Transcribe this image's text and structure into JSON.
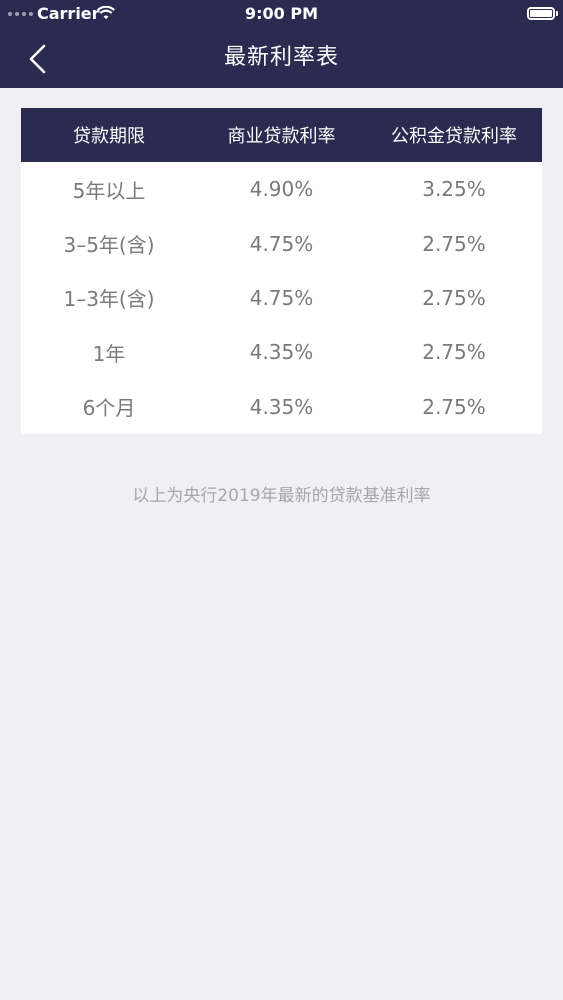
{
  "status_bar": {
    "carrier": "Carrier",
    "time": "9:00 PM"
  },
  "nav": {
    "title": "最新利率表",
    "back_icon": "chevron-left-icon"
  },
  "table": {
    "headers": [
      "贷款期限",
      "商业贷款利率",
      "公积金贷款利率"
    ],
    "rows": [
      {
        "term": "5年以上",
        "commercial": "4.90%",
        "provident": "3.25%"
      },
      {
        "term": "3–5年(含)",
        "commercial": "4.75%",
        "provident": "2.75%"
      },
      {
        "term": "1–3年(含)",
        "commercial": "4.75%",
        "provident": "2.75%"
      },
      {
        "term": "1年",
        "commercial": "4.35%",
        "provident": "2.75%"
      },
      {
        "term": "6个月",
        "commercial": "4.35%",
        "provident": "2.75%"
      }
    ]
  },
  "footnote": "以上为央行2019年最新的贷款基准利率",
  "colors": {
    "navy": "#2b2b52",
    "background": "#f0eff4",
    "cell_text": "#7a7a7a",
    "footnote_text": "#a6a6ab"
  }
}
